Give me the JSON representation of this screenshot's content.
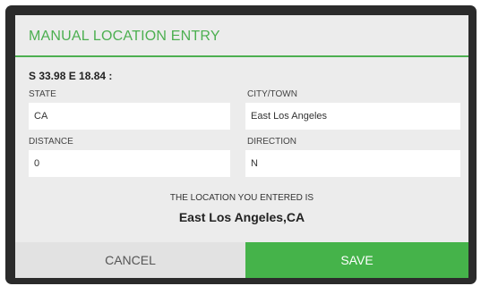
{
  "dialog": {
    "title": "MANUAL LOCATION ENTRY",
    "coordinates": "S 33.98 E 18.84 :",
    "fields": {
      "state": {
        "label": "STATE",
        "value": "CA"
      },
      "city": {
        "label": "CITY/TOWN",
        "value": "East Los Angeles"
      },
      "distance": {
        "label": "DISTANCE",
        "value": "0"
      },
      "direction": {
        "label": "DIRECTION",
        "value": "N"
      }
    },
    "result": {
      "caption": "THE LOCATION YOU ENTERED IS",
      "value": "East Los Angeles,CA"
    },
    "buttons": {
      "cancel": "CANCEL",
      "save": "SAVE"
    }
  },
  "colors": {
    "accent": "#4caf50",
    "save_button": "#45b34a",
    "dialog_background": "#ececec",
    "frame": "#2b2b2b"
  }
}
